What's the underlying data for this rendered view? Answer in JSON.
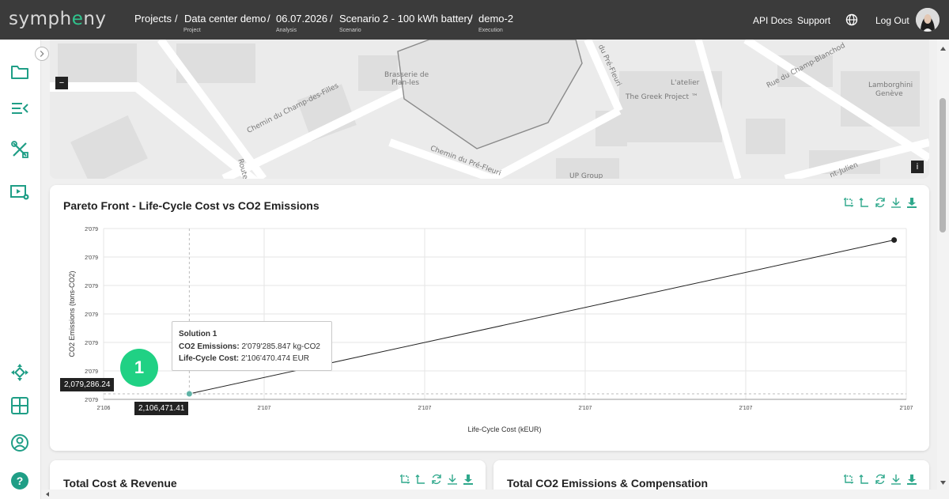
{
  "app": {
    "logo": "symph",
    "logo_accent": "e",
    "logo_rest": "ny"
  },
  "breadcrumb": [
    {
      "value": "Projects",
      "sub": "Project"
    },
    {
      "value": "Data center demo",
      "sub": "Analysis"
    },
    {
      "value": "06.07.2026",
      "sub": "Scenario"
    },
    {
      "value": "Scenario 2 - 100 kWh battery",
      "sub": "Execution"
    },
    {
      "value": "demo-2",
      "sub": ""
    }
  ],
  "crumb_separator": "/",
  "header": {
    "api_docs": "API Docs",
    "support": "Support",
    "logout": "Log Out"
  },
  "sidebar": [
    "folder-icon",
    "list-collapse-icon",
    "tools-icon",
    "video-settings-icon",
    "move-icon",
    "grid-icon",
    "user-circle-icon",
    "help-icon"
  ],
  "map": {
    "zoom_out": "−",
    "info": "i",
    "labels": {
      "brasserie": "Brasserie de",
      "plan_les": "Plan-les",
      "chemin_champ": "Chemin du Champ-des-Filles",
      "route": "Route",
      "chemin_pre_fleuri": "Chemin du Pré-Fleuri",
      "du_pre_fleuri": "du Pré-Fleuri",
      "latelier": "L'atelier",
      "greek": "The Greek Project ™",
      "rue_champ": "Rue du Champ-Blanchod",
      "lambo1": "Lamborghini",
      "lambo2": "Genève",
      "up_group": "UP Group",
      "st_julien": "nt-Julien"
    }
  },
  "pareto": {
    "title": "Pareto Front - Life-Cycle Cost vs CO2 Emissions",
    "tooltip": {
      "title": "Solution 1",
      "co2_label": "CO2 Emissions:",
      "co2_value": "2'079'285.847 kg-CO2",
      "lcc_label": "Life-Cycle Cost:",
      "lcc_value": "2'106'470.474 EUR"
    },
    "badge": "1",
    "y_flag": "2,079,286.24",
    "x_flag": "2,106,471.41"
  },
  "chart_data": {
    "type": "line",
    "title": "Pareto Front - Life-Cycle Cost vs CO2 Emissions",
    "xlabel": "Life-Cycle Cost (kEUR)",
    "ylabel": "CO2 Emissions (tons-CO2)",
    "x_tick_labels": [
      "2'106",
      "2'107",
      "2'107",
      "2'107",
      "2'107",
      "2'107"
    ],
    "y_tick_labels": [
      "2'079",
      "2'079",
      "2'079",
      "2'079",
      "2'079",
      "2'079",
      "2'079"
    ],
    "grid": true,
    "series": [
      {
        "points": [
          {
            "x": 2106.470474,
            "y": 2079.285847
          },
          {
            "x": 2107.05,
            "y": 2079.42
          }
        ]
      }
    ],
    "xlim": [
      2106.4,
      2107.06
    ],
    "ylim": [
      2079.281,
      2079.43
    ]
  },
  "cards": {
    "total_cost": "Total Cost & Revenue",
    "total_co2": "Total CO2 Emissions & Compensation"
  },
  "colors": {
    "accent": "#20d184",
    "teal": "#2fa88c",
    "topbar": "#3b3b3b"
  }
}
